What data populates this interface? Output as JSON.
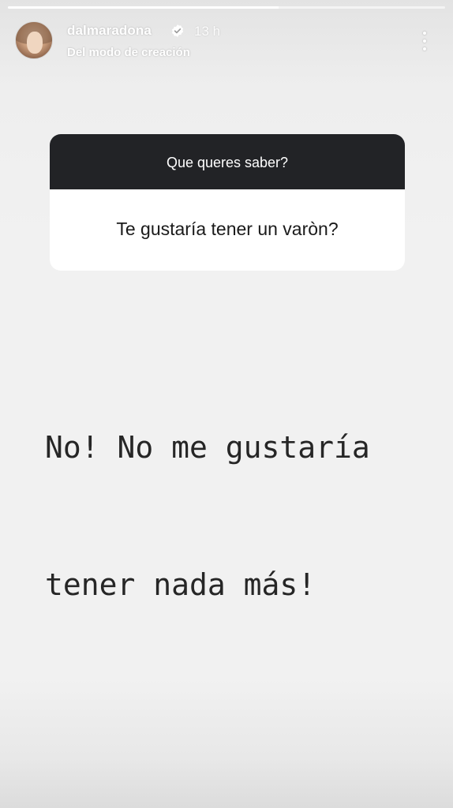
{
  "story": {
    "progress": 0.62,
    "user": {
      "username": "dalmaradona",
      "verified": true,
      "time_ago": "13 h",
      "subtitle": "Del modo de creación"
    },
    "icons": {
      "avatar": "profile-photo",
      "verified": "verified-badge-icon",
      "menu": "more-vertical-icon"
    },
    "question_card": {
      "title": "Que queres saber?",
      "question": "Te gustaría tener un varòn?"
    },
    "answer": {
      "line1": "No! No me gustaría",
      "line2": "tener nada más!"
    },
    "colors": {
      "background": "#f0f0f0",
      "card_header": "#222326",
      "card_body": "#ffffff",
      "answer_text": "#262626"
    }
  }
}
